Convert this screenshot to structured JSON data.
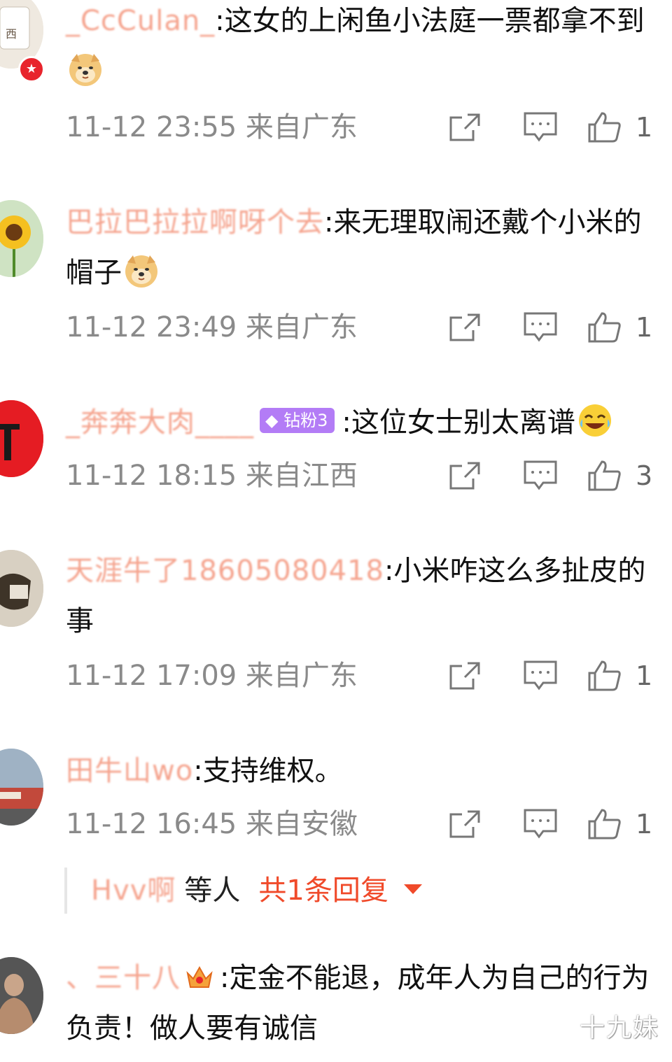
{
  "comments": [
    {
      "username": "_CcCulan_",
      "text": ":这女的上闲鱼小法庭一票都拿不到",
      "time": "11-12 23:55 来自广东",
      "likes": "1",
      "emoji": "doge"
    },
    {
      "username": "巴拉巴拉拉啊呀个去",
      "text": ":来无理取闹还戴个小米的帽子",
      "time": "11-12 23:49 来自广东",
      "likes": "1",
      "emoji": "doge"
    },
    {
      "username": "_奔奔大肉____",
      "badge": "钻粉3",
      "text": ":这位女士别太离谱",
      "time": "11-12 18:15 来自江西",
      "likes": "3",
      "emoji": "laugh-cry"
    },
    {
      "username": "天涯牛了18605080418",
      "text": ":小米咋这么多扯皮的事",
      "time": "11-12 17:09 来自广东",
      "likes": "1"
    },
    {
      "username": "田牛山wo",
      "text": ":支持维权。",
      "time": "11-12 16:45 来自安徽",
      "likes": "1"
    },
    {
      "username": "、三十八",
      "badge_level": "5",
      "text": ":定金不能退，成年人为自己的行为负责！做人要有诚信"
    }
  ],
  "reply_row": {
    "name": "Hvv啊",
    "tail": "等人",
    "count": "共1条回复"
  },
  "watermark": "十九妹",
  "colors": {
    "username": "#f49a82",
    "meta": "#8a8a8a",
    "reply_count": "#f04a2a",
    "badge_diamond": "#b37cf6"
  },
  "icons": {
    "share": "share-icon",
    "reply": "comment-icon",
    "like": "thumbs-up-icon"
  }
}
